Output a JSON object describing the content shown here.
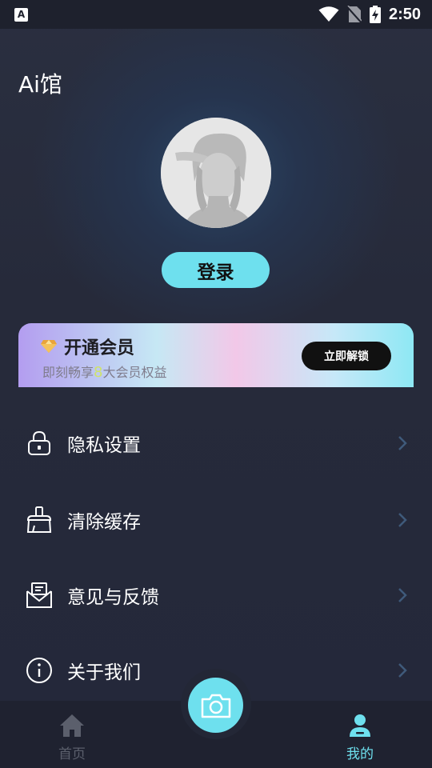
{
  "status_bar": {
    "app_icon_letter": "A",
    "time": "2:50",
    "icons": [
      "wifi-icon",
      "no-sim-icon",
      "battery-charging-icon"
    ]
  },
  "app": {
    "title": "Ai馆"
  },
  "profile": {
    "avatar_icon": "default-avatar-icon",
    "login_label": "登录"
  },
  "vip": {
    "icon": "diamond-icon",
    "title": "开通会员",
    "subtitle_prefix": "即刻畅享",
    "subtitle_number": "8",
    "subtitle_suffix": "大会员权益",
    "button_label": "立即解锁",
    "number_color": "#cfe36a"
  },
  "menu": {
    "items": [
      {
        "label": "隐私设置",
        "icon": "lock-icon"
      },
      {
        "label": "清除缓存",
        "icon": "broom-icon"
      },
      {
        "label": "意见与反馈",
        "icon": "mail-icon"
      },
      {
        "label": "关于我们",
        "icon": "info-icon"
      }
    ]
  },
  "tabs": {
    "home_label": "首页",
    "home_icon": "home-icon",
    "camera_icon": "camera-icon",
    "mine_label": "我的",
    "mine_icon": "user-icon",
    "active": "我的",
    "active_color": "#6ee0ee",
    "inactive_color": "#5b5f6c"
  },
  "colors": {
    "accent": "#6ee0ee",
    "background": "#262a3a",
    "chevron": "#3f5a7a"
  }
}
